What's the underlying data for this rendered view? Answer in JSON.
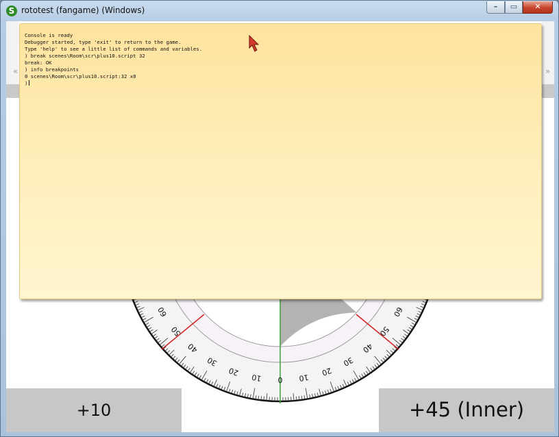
{
  "window": {
    "title": "rototest (fangame)  (Windows)",
    "app_icon_glyph": "S",
    "controls": {
      "minimize": "–",
      "maximize": "▭",
      "close": "✕"
    }
  },
  "console": {
    "lines": [
      "Console is ready",
      "Debugger started, type 'exit' to return to the game.",
      "Type 'help' to see a little list of commands and variables.",
      ") break scenes\\Room\\scr\\plus10.script 32",
      "break: OK",
      ") info breakpoints",
      "0 scenes\\Room\\scr\\plus10.script:32 x0"
    ],
    "prompt": ")"
  },
  "protractor": {
    "scale_labels_left": [
      "0",
      "10",
      "20",
      "30",
      "40",
      "50",
      "60"
    ],
    "scale_labels_right": [
      "10",
      "20",
      "30",
      "40",
      "50",
      "60"
    ]
  },
  "buttons": {
    "plus10": "+10",
    "plus45_inner": "+45 (Inner)"
  },
  "nav": {
    "left_arrow": "«",
    "right_arrow": "»"
  },
  "colors": {
    "console_bg": "#fee39e",
    "marker_red": "#d21e1e",
    "center_line": "#3aa03a",
    "button_gray": "#c7c7c7"
  },
  "icons": {
    "app": "app-logo-icon",
    "cursor": "mouse-pointer-icon"
  }
}
